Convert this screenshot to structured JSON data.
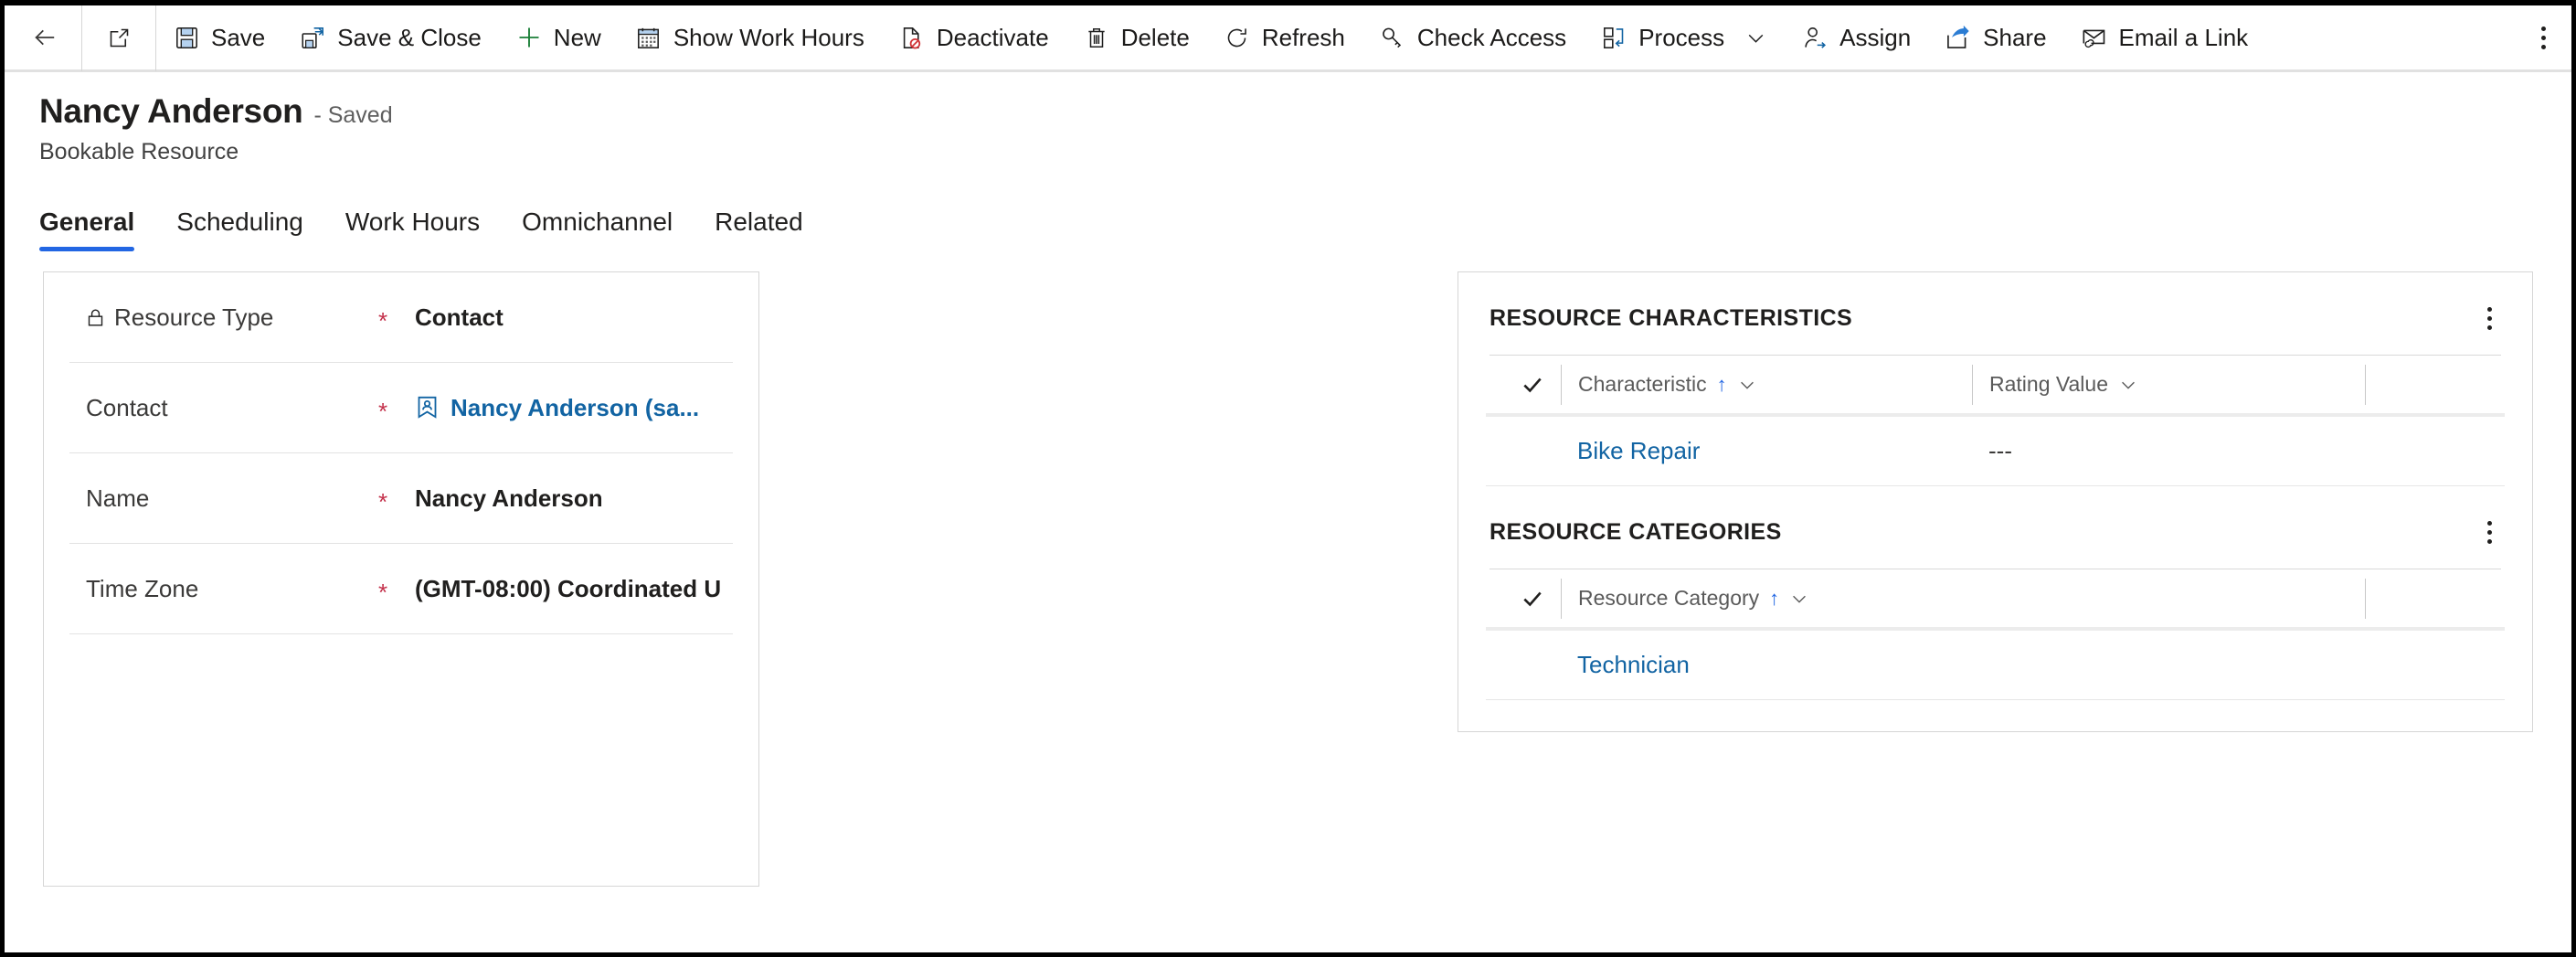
{
  "commandbar": {
    "back_label": "",
    "popout_label": "",
    "buttons": [
      {
        "icon": "save-icon",
        "label": "Save"
      },
      {
        "icon": "save-close-icon",
        "label": "Save & Close"
      },
      {
        "icon": "plus-icon",
        "label": "New"
      },
      {
        "icon": "calendar-icon",
        "label": "Show Work Hours"
      },
      {
        "icon": "deactivate-icon",
        "label": "Deactivate"
      },
      {
        "icon": "trash-icon",
        "label": "Delete"
      },
      {
        "icon": "refresh-icon",
        "label": "Refresh"
      },
      {
        "icon": "key-icon",
        "label": "Check Access"
      },
      {
        "icon": "process-icon",
        "label": "Process",
        "chevron": true
      },
      {
        "icon": "assign-icon",
        "label": "Assign"
      },
      {
        "icon": "share-icon",
        "label": "Share"
      },
      {
        "icon": "email-link-icon",
        "label": "Email a Link"
      }
    ],
    "overflow_label": "More commands"
  },
  "header": {
    "title": "Nancy Anderson",
    "state": "- Saved",
    "subtitle": "Bookable Resource"
  },
  "tabs": [
    {
      "label": "General",
      "active": true
    },
    {
      "label": "Scheduling",
      "active": false
    },
    {
      "label": "Work Hours",
      "active": false
    },
    {
      "label": "Omnichannel",
      "active": false
    },
    {
      "label": "Related",
      "active": false
    }
  ],
  "form": {
    "fields": [
      {
        "label": "Resource Type",
        "locked": true,
        "required": "*",
        "value": "Contact",
        "link": false
      },
      {
        "label": "Contact",
        "locked": false,
        "required": "*",
        "value": "Nancy Anderson (sa...",
        "link": true
      },
      {
        "label": "Name",
        "locked": false,
        "required": "*",
        "value": "Nancy Anderson",
        "link": false
      },
      {
        "label": "Time Zone",
        "locked": false,
        "required": "*",
        "value": "(GMT-08:00) Coordinated U",
        "link": false
      }
    ]
  },
  "subgrids": [
    {
      "title": "RESOURCE CHARACTERISTICS",
      "columns": [
        {
          "label": "Characteristic",
          "sorted": "↑"
        },
        {
          "label": "Rating Value",
          "sorted": ""
        }
      ],
      "rows": [
        {
          "c1": "Bike Repair",
          "c2": "---"
        }
      ]
    },
    {
      "title": "RESOURCE CATEGORIES",
      "columns": [
        {
          "label": "Resource Category",
          "sorted": "↑"
        }
      ],
      "rows": [
        {
          "c1": "Technician",
          "c2": ""
        }
      ]
    }
  ],
  "colors": {
    "accent": "#2266e3",
    "link": "#1264a3",
    "required": "#c4314b",
    "text": "#201f1e",
    "border": "#d6d6d6"
  }
}
